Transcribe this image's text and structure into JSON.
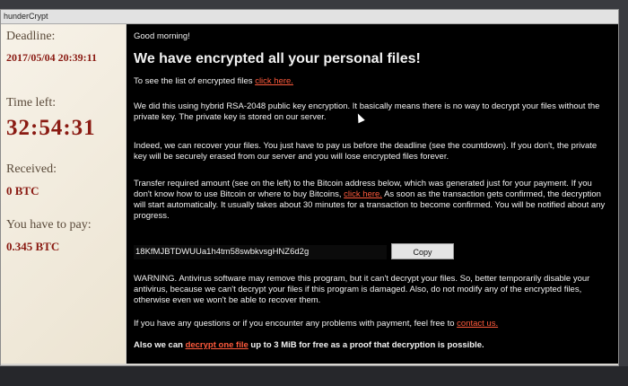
{
  "window": {
    "title": "hunderCrypt"
  },
  "sidebar": {
    "deadline_label": "Deadline:",
    "deadline_value": "2017/05/04 20:39:11",
    "time_left_label": "Time left:",
    "time_left_value": "32:54:31",
    "received_label": "Received:",
    "received_value": "0 BTC",
    "pay_label": "You have to pay:",
    "pay_value": "0.345 BTC"
  },
  "main": {
    "greeting": "Good morning!",
    "headline": "We have encrypted all your personal files!",
    "list_text": "To see the list of encrypted files",
    "list_link": "click here.",
    "para1": "We did this using hybrid RSA-2048 public key encryption. It basically means there is no way to decrypt your files without the private key. The private key is stored on our server.",
    "para2": "Indeed, we can recover your files. You just have to pay us before the deadline (see the countdown). If you don't, the private key will be securely erased from our server and you will lose encrypted files forever.",
    "para3_a": "Transfer required amount (see on the left) to the Bitcoin address below, which was generated just for your payment. If you don't know how to use Bitcoin or where to buy Bitcoins,",
    "para3_link": "click here.",
    "para3_b": "As soon as the transaction gets confirmed, the decryption will start automatically. It usually takes about 30 minutes for a transaction to become confirmed. You will be notified about any progress.",
    "address": "18KfMJBTDWUUa1h4tm58swbkvsgHNZ6d2g",
    "copy_label": "Copy",
    "warning": "WARNING. Antivirus software may remove this program, but it can't decrypt your files. So, better temporarily disable your antivirus, because we can't decrypt your files if this program is damaged. Also, do not modify any of the encrypted files, otherwise even we won't be able to recover them.",
    "contact_text": "If you have any questions or if you encounter any problems with payment, feel free to",
    "contact_link": "contact us.",
    "free_a": "Also we can",
    "free_link": "decrypt one file",
    "free_b": "up to 3 MiB for free as a proof that decryption is possible."
  },
  "colors": {
    "accent_red": "#8a1a12",
    "link_orange": "#ff5a3c",
    "panel_black": "#000000",
    "sidebar_paper": "#f4efe4"
  }
}
